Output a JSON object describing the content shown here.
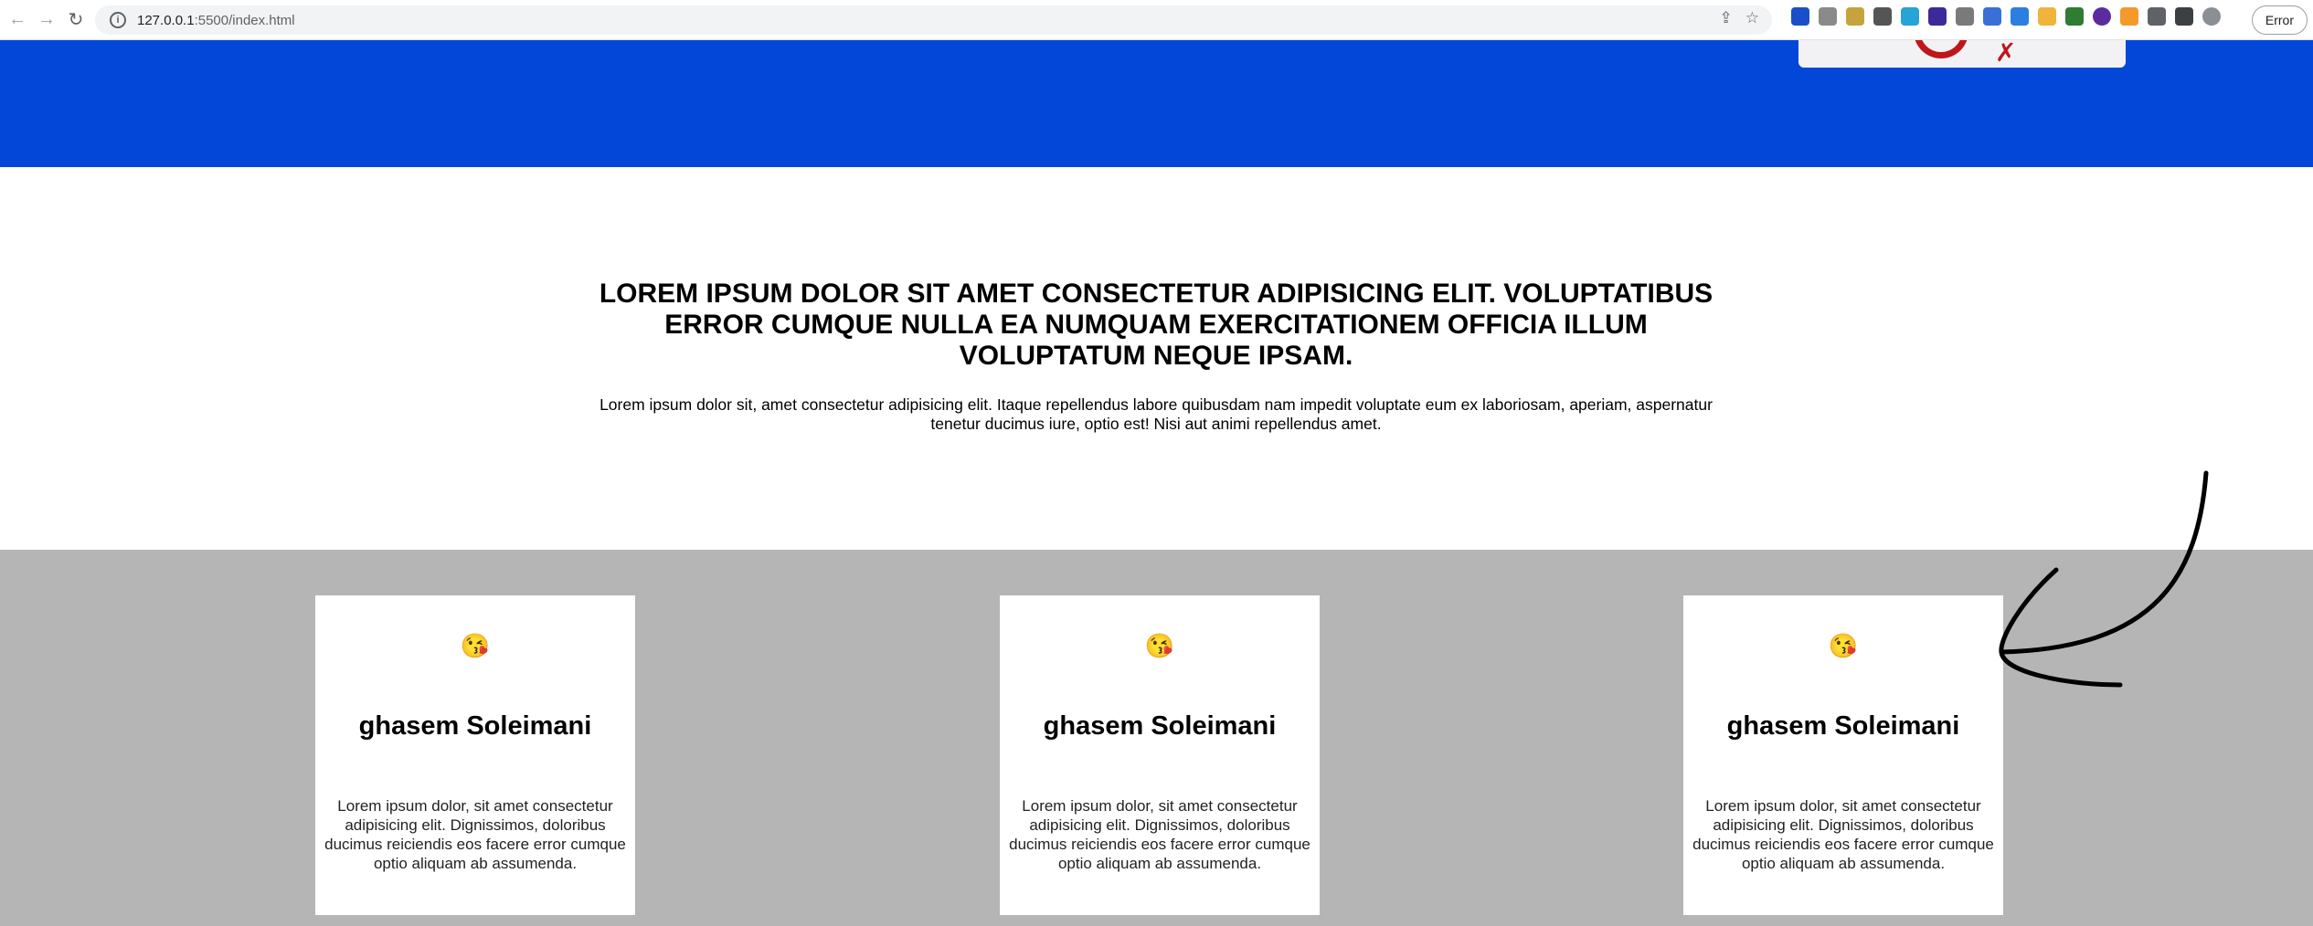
{
  "browser": {
    "url_host": "127.0.0.1",
    "url_rest": ":5500/index.html",
    "error_label": "Error"
  },
  "intro": {
    "heading": "LOREM IPSUM DOLOR SIT AMET CONSECTETUR ADIPISICING ELIT. VOLUPTATIBUS ERROR CUMQUE NULLA EA NUMQUAM EXERCITATIONEM OFFICIA ILLUM VOLUPTATUM NEQUE IPSAM.",
    "paragraph": "Lorem ipsum dolor sit, amet consectetur adipisicing elit. Itaque repellendus labore quibusdam nam impedit voluptate eum ex laboriosam, aperiam, aspernatur tenetur ducimus iure, optio est! Nisi aut animi repellendus amet."
  },
  "cards": [
    {
      "emoji": "😘",
      "title": "ghasem Soleimani",
      "text": "Lorem ipsum dolor, sit amet consectetur adipisicing elit. Dignissimos, doloribus ducimus reiciendis eos facere error cumque optio aliquam ab assumenda."
    },
    {
      "emoji": "😘",
      "title": "ghasem Soleimani",
      "text": "Lorem ipsum dolor, sit amet consectetur adipisicing elit. Dignissimos, doloribus ducimus reiciendis eos facere error cumque optio aliquam ab assumenda."
    },
    {
      "emoji": "😘",
      "title": "ghasem Soleimani",
      "text": "Lorem ipsum dolor, sit amet consectetur adipisicing elit. Dignissimos, doloribus ducimus reiciendis eos facere error cumque optio aliquam ab assumenda."
    }
  ],
  "colors": {
    "header_blue": "#0247d8",
    "cards_bg": "#b5b5b5"
  }
}
